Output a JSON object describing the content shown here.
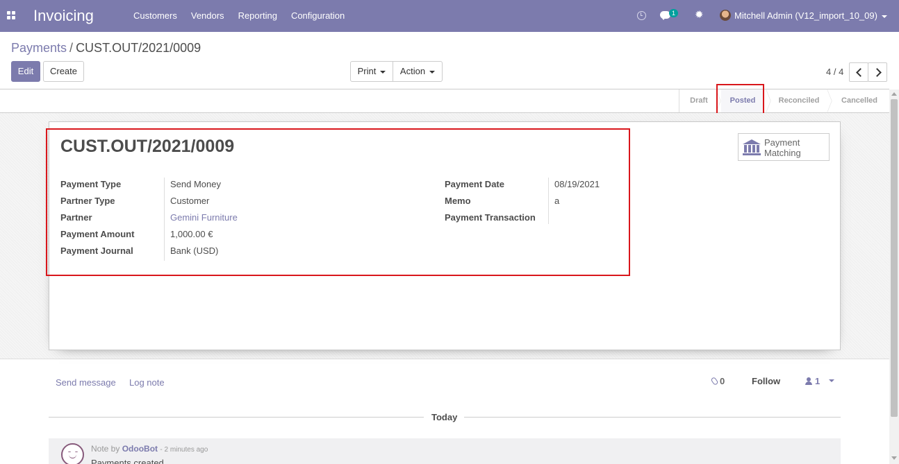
{
  "navbar": {
    "brand": "Invoicing",
    "menu": [
      "Customers",
      "Vendors",
      "Reporting",
      "Configuration"
    ],
    "message_count": "1",
    "user": "Mitchell Admin (V12_import_10_09)",
    "accent_color": "#7c7bad"
  },
  "breadcrumb": {
    "parent": "Payments",
    "separator": "/",
    "current": "CUST.OUT/2021/0009"
  },
  "toolbar": {
    "edit_label": "Edit",
    "create_label": "Create",
    "print_label": "Print",
    "action_label": "Action"
  },
  "pager": {
    "value": "4 / 4"
  },
  "statusbar": {
    "stages": [
      "Draft",
      "Posted",
      "Reconciled",
      "Cancelled"
    ],
    "active": "Posted"
  },
  "smart_button": {
    "line1": "Payment",
    "line2": "Matching",
    "icon": "bank-icon"
  },
  "form": {
    "title": "CUST.OUT/2021/0009",
    "left_fields": [
      {
        "label": "Payment Type",
        "value": "Send Money"
      },
      {
        "label": "Partner Type",
        "value": "Customer"
      },
      {
        "label": "Partner",
        "value": "Gemini Furniture"
      },
      {
        "label": "Payment Amount",
        "value": "1,000.00 €"
      },
      {
        "label": "Payment Journal",
        "value": "Bank (USD)"
      }
    ],
    "right_fields": [
      {
        "label": "Payment Date",
        "value": "08/19/2021"
      },
      {
        "label": "Memo",
        "value": "a"
      },
      {
        "label": "Payment Transaction",
        "value": ""
      }
    ]
  },
  "chatter": {
    "send_message": "Send message",
    "log_note": "Log note",
    "attachments": "0",
    "follow": "Follow",
    "followers": "1",
    "separator": "Today",
    "message": {
      "prefix": "Note by",
      "author": "OdooBot",
      "time": "- 2 minutes ago",
      "body": "Payments created"
    }
  }
}
